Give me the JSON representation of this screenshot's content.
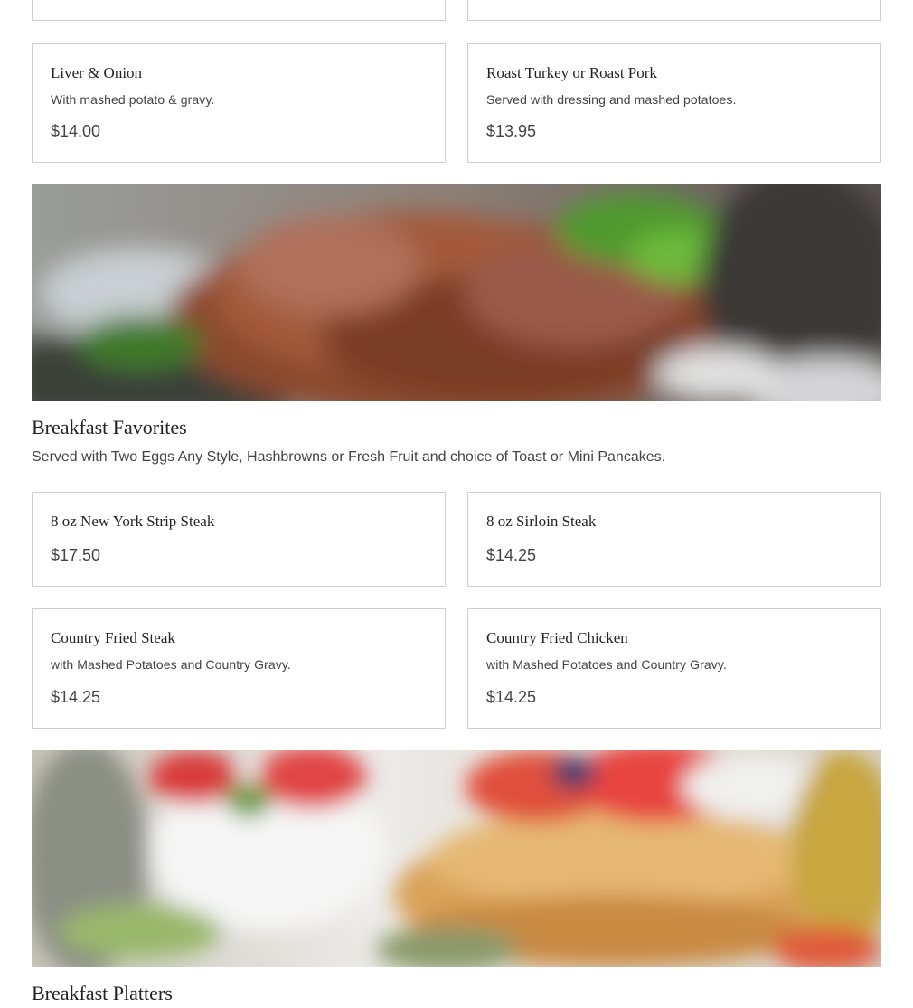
{
  "top_section": {
    "items": [
      {
        "name": "Liver & Onion",
        "description": "With mashed potato & gravy.",
        "price": "$14.00"
      },
      {
        "name": "Roast Turkey or Roast Pork",
        "description": "Served with dressing and mashed potatoes.",
        "price": "$13.95"
      }
    ]
  },
  "breakfast_favorites": {
    "title": "Breakfast Favorites",
    "description": "Served with Two Eggs Any Style, Hashbrowns or Fresh Fruit and choice of Toast or Mini Pancakes.",
    "banner_image": "roast-meat-photo",
    "items": [
      {
        "name": "8 oz New York Strip Steak",
        "price": "$17.50"
      },
      {
        "name": "8 oz Sirloin Steak",
        "price": "$14.25"
      },
      {
        "name": "Country Fried Steak",
        "description": "with Mashed Potatoes and Country Gravy.",
        "price": "$14.25"
      },
      {
        "name": "Country Fried Chicken",
        "description": "with Mashed Potatoes and Country Gravy.",
        "price": "$14.25"
      }
    ]
  },
  "breakfast_platters": {
    "title": "Breakfast Platters",
    "banner_image": "pancakes-fruit-photo"
  }
}
